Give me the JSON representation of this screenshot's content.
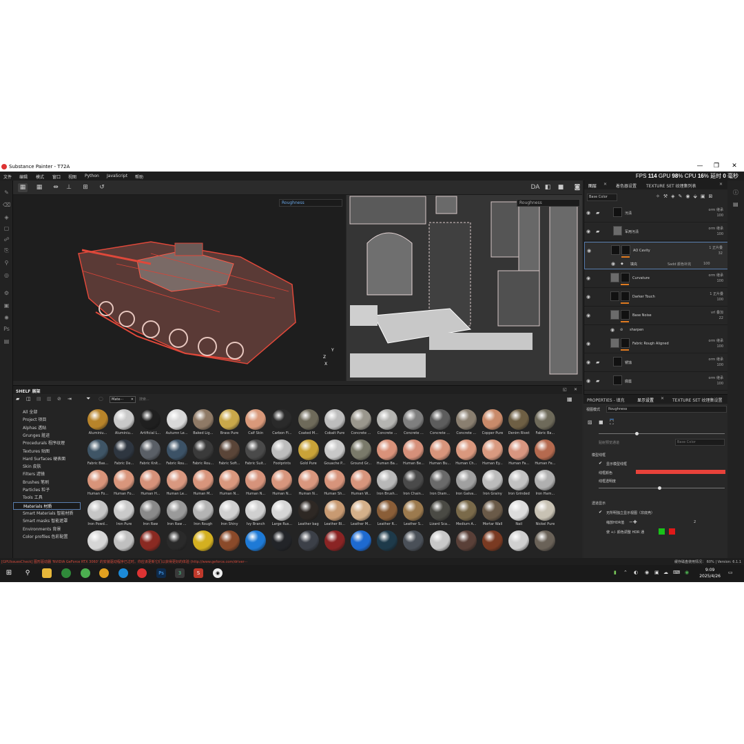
{
  "window": {
    "title": "Substance Painter - T72A",
    "minimize": "—",
    "maximize": "❐",
    "close": "✕"
  },
  "menu": [
    "文件",
    "编辑",
    "模式",
    "窗口",
    "视图",
    "Python",
    "JavaScript",
    "帮助"
  ],
  "perf": {
    "fps_label": "FPS",
    "fps": "114",
    "gpu_label": "GPU",
    "gpu": "98",
    "cpu_label": "CPU",
    "cpu": "16",
    "latency_label": "延时",
    "latency": "0",
    "latency_unit": "毫秒",
    "percent": "%"
  },
  "viewport": {
    "left_channel": "Roughness",
    "right_channel": "Roughness",
    "gizmo": {
      "x": "X",
      "y": "Y",
      "z": "Z"
    },
    "toolbar_right_label": "DA"
  },
  "shelf": {
    "title": "SHELF 展架",
    "chip": "Mate···",
    "search_placeholder": "搜索...",
    "categories": [
      "All 全部",
      "Project 项目",
      "Alphas 透贴",
      "Grunges 脏迹",
      "Procedurals 程序纹理",
      "Textures 贴图",
      "Hard Surfaces 硬表面",
      "Skin 皮肤",
      "Filters 滤镜",
      "Brushes 笔刷",
      "Particles 粒子",
      "Tools 工具",
      "Materials 材质",
      "Smart Materials 智能材质",
      "Smart masks 智能遮罩",
      "Environments 背景",
      "Color profiles 色彩配置"
    ],
    "selected_category": "Materials 材质",
    "materials": [
      {
        "label": "Aluminiu...",
        "color": "#b8842a"
      },
      {
        "label": "Aluminiu...",
        "color": "#c9c9c9"
      },
      {
        "label": "Artificial L...",
        "color": "#1f1f1f"
      },
      {
        "label": "Autumn Le...",
        "color": "#d9d9d9"
      },
      {
        "label": "Baked Lig...",
        "color": "#8f7a66"
      },
      {
        "label": "Brass Pure",
        "color": "#c9a84a"
      },
      {
        "label": "Calf Skin",
        "color": "#d9997a"
      },
      {
        "label": "Carbon Fi...",
        "color": "#2a2a2a"
      },
      {
        "label": "Coated M...",
        "color": "#6e6a5a"
      },
      {
        "label": "Cobalt Pure",
        "color": "#bdbdbd"
      },
      {
        "label": "Concrete ...",
        "color": "#9a978d"
      },
      {
        "label": "Concrete ...",
        "color": "#b5b5b2"
      },
      {
        "label": "Concrete ...",
        "color": "#7f7f7f"
      },
      {
        "label": "Concrete ...",
        "color": "#5d5d5d"
      },
      {
        "label": "Concrete ...",
        "color": "#8a7f70"
      },
      {
        "label": "Copper Pure",
        "color": "#c98a6a"
      },
      {
        "label": "Denim Rivet",
        "color": "#6e5f44"
      },
      {
        "label": "Fabric Ba...",
        "color": "#6e6a5a"
      },
      {
        "label": "Fabric Bas...",
        "color": "#3f5566"
      },
      {
        "label": "Fabric De...",
        "color": "#2e3640"
      },
      {
        "label": "Fabric Knit...",
        "color": "#5a5f66"
      },
      {
        "label": "Fabric Rou...",
        "color": "#3c5266"
      },
      {
        "label": "Fabric Rou...",
        "color": "#3a3a3a"
      },
      {
        "label": "Fabric Soft...",
        "color": "#5a4538"
      },
      {
        "label": "Fabric Suit...",
        "color": "#4a4a4a"
      },
      {
        "label": "Footprints",
        "color": "#bdbdbd"
      },
      {
        "label": "Gold Pure",
        "color": "#c9a338"
      },
      {
        "label": "Gouache P...",
        "color": "#c8c8c8"
      },
      {
        "label": "Ground Gr...",
        "color": "#7a7a6a"
      },
      {
        "label": "Human Ba...",
        "color": "#d9927a"
      },
      {
        "label": "Human Be...",
        "color": "#d6907a"
      },
      {
        "label": "Human Bu...",
        "color": "#d8957c"
      },
      {
        "label": "Human Ch...",
        "color": "#da987e"
      },
      {
        "label": "Human Ey...",
        "color": "#d99a80"
      },
      {
        "label": "Human Fa...",
        "color": "#d89680"
      },
      {
        "label": "Human Fe...",
        "color": "#b56a4f"
      },
      {
        "label": "Human Fo...",
        "color": "#d8947a"
      },
      {
        "label": "Human Fo...",
        "color": "#d9967c"
      },
      {
        "label": "Human H...",
        "color": "#d6927a"
      },
      {
        "label": "Human Le...",
        "color": "#d99880"
      },
      {
        "label": "Human M...",
        "color": "#d8957c"
      },
      {
        "label": "Human N...",
        "color": "#d9987e"
      },
      {
        "label": "Human N...",
        "color": "#d6937b"
      },
      {
        "label": "Human N...",
        "color": "#d8967d"
      },
      {
        "label": "Human N...",
        "color": "#d9977e"
      },
      {
        "label": "Human Sh...",
        "color": "#d7947b"
      },
      {
        "label": "Human W...",
        "color": "#d8957c"
      },
      {
        "label": "Iron Brush...",
        "color": "#b8b8b8"
      },
      {
        "label": "Iron Chain...",
        "color": "#4a4a4a"
      },
      {
        "label": "Iron Diam...",
        "color": "#6a6a6a"
      },
      {
        "label": "Iron Galva...",
        "color": "#a0a0a0"
      },
      {
        "label": "Iron Grainy",
        "color": "#bcbcbc"
      },
      {
        "label": "Iron Grinded",
        "color": "#c2c2c2"
      },
      {
        "label": "Iron Ham...",
        "color": "#b0b0b0"
      },
      {
        "label": "Iron Powd...",
        "color": "#c6c6c6"
      },
      {
        "label": "Iron Pure",
        "color": "#cacaca"
      },
      {
        "label": "Iron Raw",
        "color": "#8a8a8a"
      },
      {
        "label": "Iron Raw ...",
        "color": "#9a9a9a"
      },
      {
        "label": "Iron Rough",
        "color": "#b4b4b4"
      },
      {
        "label": "Iron Shiny",
        "color": "#d0d0d0"
      },
      {
        "label": "Ivy Branch",
        "color": "#d0d0d0"
      },
      {
        "label": "Large Rus...",
        "color": "#d6d6d6"
      },
      {
        "label": "Leather bag",
        "color": "#2e2824"
      },
      {
        "label": "Leather Bl...",
        "color": "#c89a72"
      },
      {
        "label": "Leather M...",
        "color": "#d4b08a"
      },
      {
        "label": "Leather R...",
        "color": "#8a5e38"
      },
      {
        "label": "Leather S...",
        "color": "#9c7a4e"
      },
      {
        "label": "Lizard Sca...",
        "color": "#4a4a44"
      },
      {
        "label": "Medium A...",
        "color": "#7a6a4a"
      },
      {
        "label": "Mortar Wall",
        "color": "#6a5a48"
      },
      {
        "label": "Nail",
        "color": "#dcdcdc"
      },
      {
        "label": "Nickel Pure",
        "color": "#c8c2b4"
      },
      {
        "label": "",
        "color": "#d6d6d6"
      },
      {
        "label": "",
        "color": "#c0c0c0"
      },
      {
        "label": "",
        "color": "#8a2a22"
      },
      {
        "label": "",
        "color": "#2a2a2a"
      },
      {
        "label": "",
        "color": "#d4b020"
      },
      {
        "label": "",
        "color": "#8a4a2a"
      },
      {
        "label": "",
        "color": "#1e7ad6"
      },
      {
        "label": "",
        "color": "#222428"
      },
      {
        "label": "",
        "color": "#3c4048"
      },
      {
        "label": "",
        "color": "#8a2424"
      },
      {
        "label": "",
        "color": "#1e6ad0"
      },
      {
        "label": "",
        "color": "#1e3a4a"
      },
      {
        "label": "",
        "color": "#4a5058"
      },
      {
        "label": "",
        "color": "#c8c8c8"
      },
      {
        "label": "",
        "color": "#5a4038"
      },
      {
        "label": "",
        "color": "#7a3a22"
      },
      {
        "label": "",
        "color": "#d0d0d0"
      },
      {
        "label": "",
        "color": "#6a6258"
      }
    ]
  },
  "layers_panel": {
    "tabs": [
      "图层",
      "着色器设置",
      "TEXTURE SET 纹理集列表"
    ],
    "channel": "Base Color",
    "layers": [
      {
        "name": "污渍",
        "blend": "orm 继承",
        "opacity": "100",
        "thumb": "dark",
        "folder": true
      },
      {
        "name": "军用污渍",
        "blend": "orm 继承",
        "opacity": "100",
        "thumb": "grey",
        "folder": true
      },
      {
        "name": "AO Cavity",
        "blend": "1 正片叠",
        "opacity": "32",
        "thumb": "dark",
        "selected": true
      },
      {
        "name": "Curvature",
        "blend": "orm 继承",
        "opacity": "100",
        "thumb": "grey"
      },
      {
        "name": "Darker Touch",
        "blend": "1 正片叠",
        "opacity": "100",
        "thumb": "dark"
      },
      {
        "name": "Base Noise",
        "blend": "vrl 叠加",
        "opacity": "22",
        "thumb": "grey"
      },
      {
        "name": "Fabric Rough Aligned",
        "blend": "orm 继承",
        "opacity": "100",
        "thumb": "grey"
      },
      {
        "name": "锈蚀",
        "blend": "orm 继承",
        "opacity": "100",
        "thumb": "dark",
        "folder": true
      },
      {
        "name": "底座",
        "blend": "orm 继承",
        "opacity": "100",
        "thumb": "dark",
        "folder": true
      }
    ],
    "fill_sub": {
      "name": "填充",
      "blend": "Sadd 颜色补完",
      "opacity": "100"
    },
    "sharpen_sub": {
      "name": "sharpen"
    }
  },
  "properties": {
    "tabs": [
      "PROPERTIES - 填充",
      "显示设置",
      "TEXTURE SET 纹理集设置"
    ],
    "view_mode_label": "视图模式",
    "view_mode": "Roughness",
    "bg_label": "贴射预览通道",
    "bg_value": "Base Color",
    "wireframe_section": "模型线框",
    "show_wireframe": "显示模型线框",
    "wireframe_color_label": "线框颜色",
    "wireframe_color": "#e8423a",
    "wireframe_opacity_label": "线框透明度",
    "display_section": "透道显示",
    "isolate_label": "无所明独立显示视图（非底壳）",
    "hdr_label": "缩放HDR值",
    "hdr_value": "2",
    "adjust_label": "使 +/- 颜色调整 HDR 通",
    "adjust_color_a": "#19c219",
    "adjust_color_b": "#e01919"
  },
  "status": {
    "left": "[GPUIssuesCheck] 图形驱动器 'NVIDIA GeForce RTX 3060' 的安装驱动程序已过时。你应该更新它们以获得更好的体验 (http://www.geforce.com/driver···",
    "right": "缓存磁盘使用情况： 60% | Version: 6.1.1"
  },
  "taskbar": {
    "time": "9:09",
    "date": "2025/4/26"
  }
}
